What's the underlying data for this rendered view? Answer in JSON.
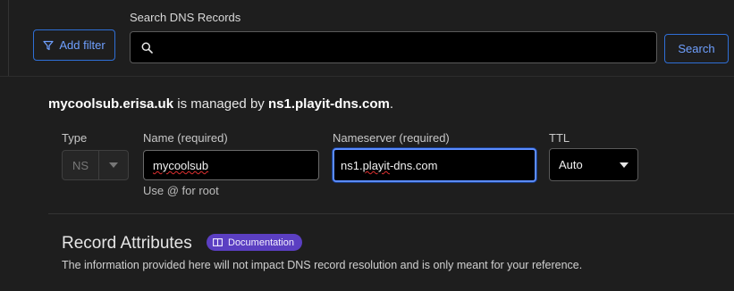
{
  "filters": {
    "add_filter_label": "Add filter"
  },
  "search": {
    "label": "Search DNS Records",
    "value": "",
    "button_label": "Search"
  },
  "managed_notice": {
    "domain": "mycoolsub.erisa.uk",
    "middle": " is managed by ",
    "nameserver": "ns1.playit-dns.com",
    "suffix": "."
  },
  "form": {
    "type": {
      "label": "Type",
      "value": "NS"
    },
    "name": {
      "label": "Name (required)",
      "value": "mycoolsub",
      "hint": "Use @ for root"
    },
    "nameserver": {
      "label": "Nameserver (required)",
      "value_prefix": "ns1.",
      "value_flagged": "playit",
      "value_suffix": "-dns.com"
    },
    "ttl": {
      "label": "TTL",
      "value": "Auto"
    }
  },
  "record_attributes": {
    "title": "Record Attributes",
    "doc_badge": "Documentation",
    "description": "The information provided here will not impact DNS record resolution and is only meant for your reference."
  },
  "colors": {
    "accent": "#2f6fd6",
    "accent_text": "#6fa0ff",
    "focus_ring": "#5b8cff",
    "badge": "#5b3fc2",
    "spellcheck": "#e03030"
  },
  "icons": {
    "filter": "filter-icon",
    "search": "search-icon",
    "caret": "chevron-down-icon",
    "book": "book-icon"
  }
}
